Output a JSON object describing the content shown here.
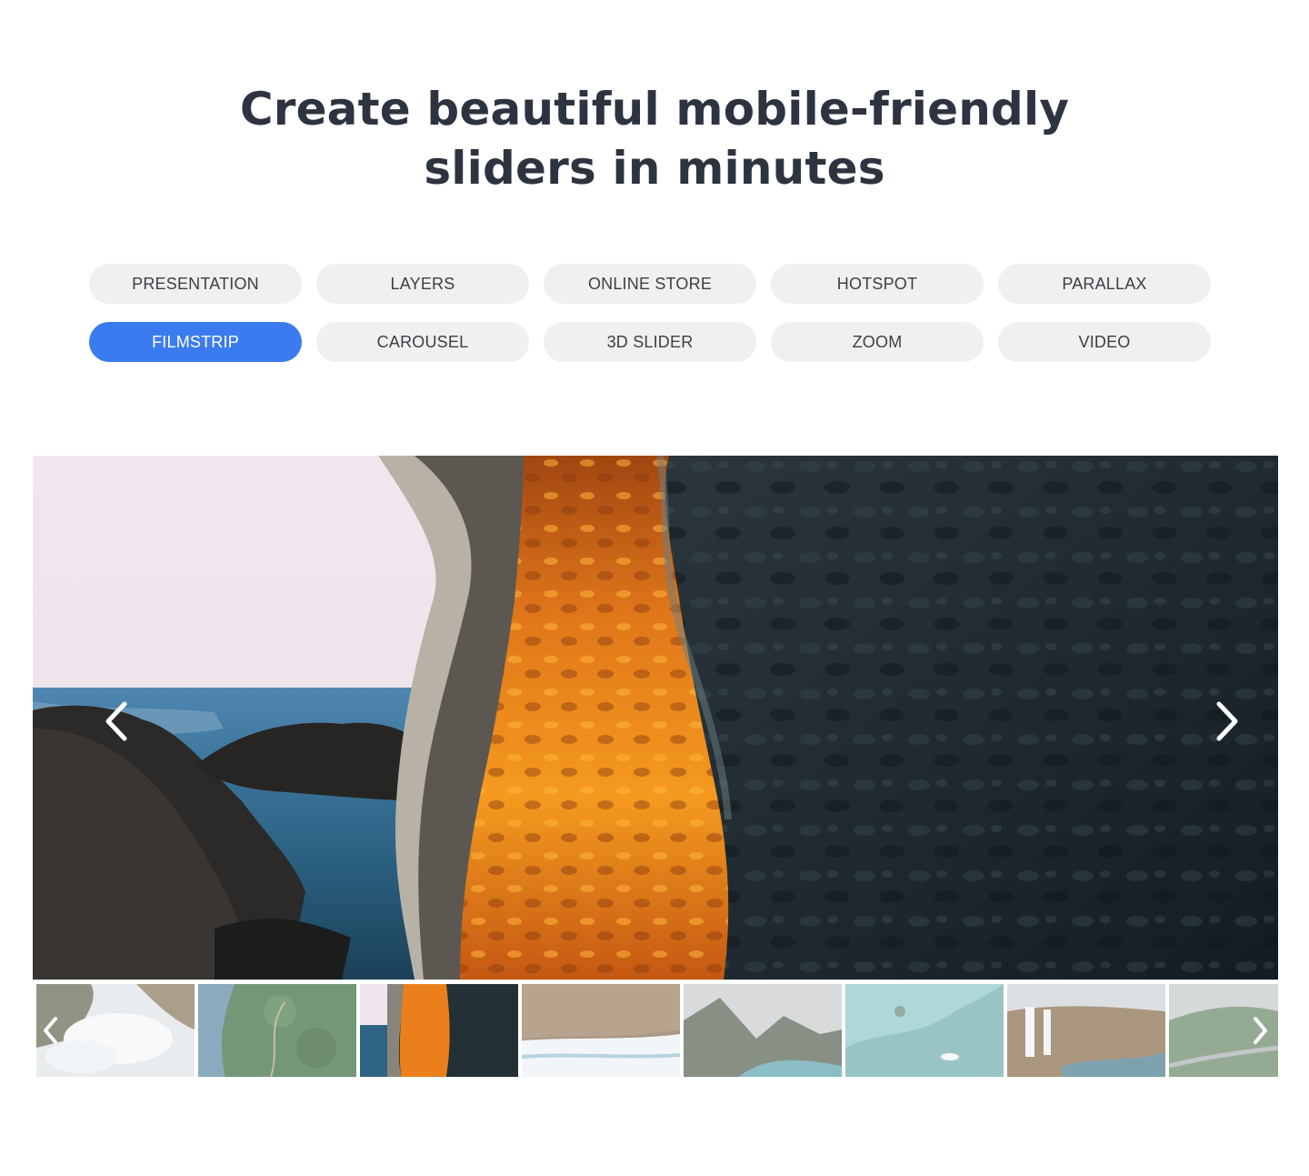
{
  "headline": {
    "line1": "Create beautiful mobile-friendly",
    "line2": "sliders in minutes"
  },
  "tabs": {
    "row1": [
      "PRESENTATION",
      "LAYERS",
      "ONLINE STORE",
      "HOTSPOT",
      "PARALLAX"
    ],
    "row2": [
      "FILMSTRIP",
      "CAROUSEL",
      "3D SLIDER",
      "ZOOM",
      "VIDEO"
    ],
    "active": "FILMSTRIP"
  },
  "colors": {
    "accent": "#3a7cf0",
    "tab_bg": "#f0f0f0",
    "headline": "#2d3440"
  },
  "slider": {
    "main_image": "sea-cave-cliff-photo",
    "prev_icon": "chevron-left-icon",
    "next_icon": "chevron-right-icon"
  },
  "filmstrip": {
    "thumbnails": [
      "waves-on-rocks-aerial",
      "forest-aerial",
      "sea-cave-cliff",
      "rocky-shore-waves",
      "mountain-bay",
      "turquoise-lagoon-boat",
      "waterfall-river",
      "coastal-road-hills"
    ],
    "active_index": 2
  }
}
